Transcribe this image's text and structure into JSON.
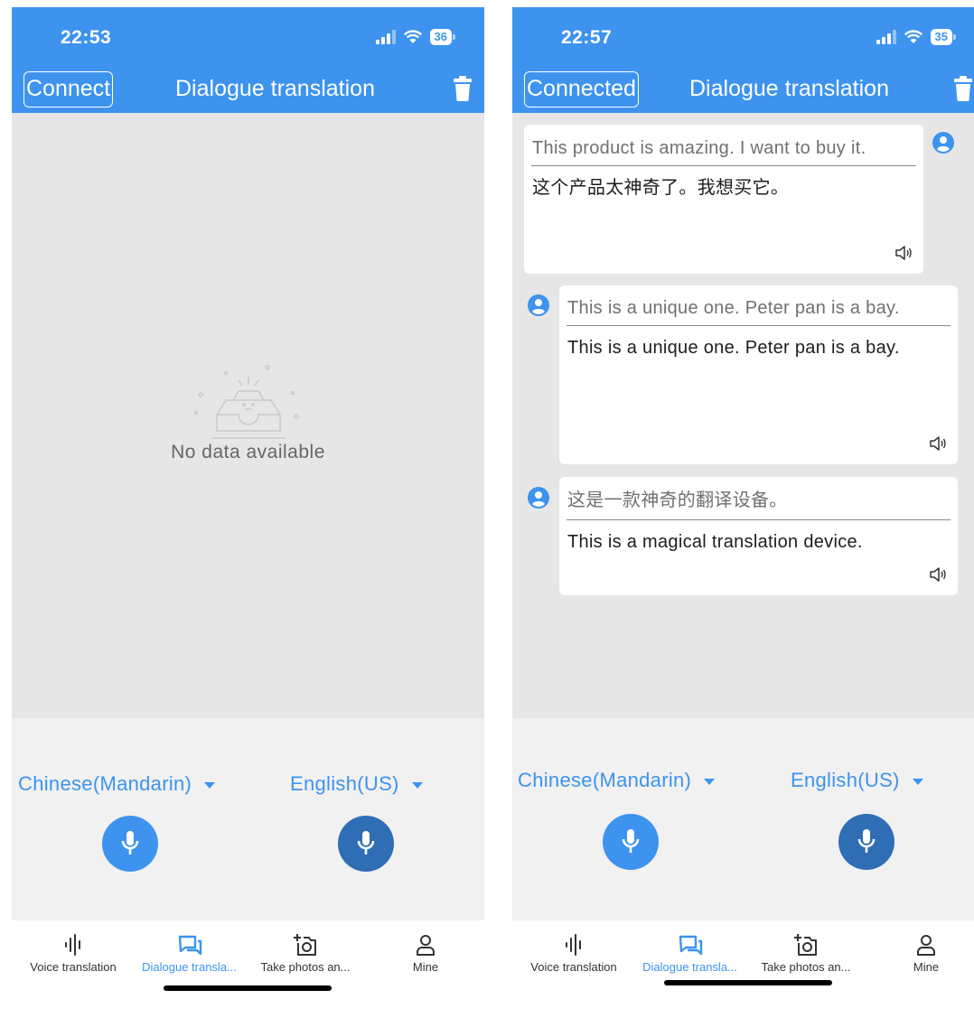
{
  "left": {
    "status": {
      "time": "22:53",
      "battery": "36"
    },
    "header": {
      "connect_label": "Connect",
      "title": "Dialogue translation"
    },
    "empty_text": "No data available",
    "languages": {
      "source": "Chinese(Mandarin)",
      "target": "English(US)"
    },
    "tabs": [
      {
        "label": "Voice translation",
        "icon": "waveform-icon"
      },
      {
        "label": "Dialogue transla...",
        "icon": "chat-icon"
      },
      {
        "label": "Take photos an...",
        "icon": "camera-icon"
      },
      {
        "label": "Mine",
        "icon": "person-icon"
      }
    ]
  },
  "right": {
    "status": {
      "time": "22:57",
      "battery": "35"
    },
    "header": {
      "connect_label": "Connected",
      "title": "Dialogue translation"
    },
    "messages": [
      {
        "speaker": "target",
        "source": "This product is amazing. I want to buy it.",
        "translation": "这个产品太神奇了。我想买它。"
      },
      {
        "speaker": "source",
        "source": "This is a unique one. Peter pan is a bay.",
        "translation": "This is a unique one. Peter pan is a bay."
      },
      {
        "speaker": "source",
        "source": "这是一款神奇的翻译设备。",
        "translation": "This is a magical translation device."
      }
    ],
    "languages": {
      "source": "Chinese(Mandarin)",
      "target": "English(US)"
    },
    "tabs": [
      {
        "label": "Voice translation",
        "icon": "waveform-icon"
      },
      {
        "label": "Dialogue transla...",
        "icon": "chat-icon"
      },
      {
        "label": "Take photos an...",
        "icon": "camera-icon"
      },
      {
        "label": "Mine",
        "icon": "person-icon"
      }
    ]
  },
  "colors": {
    "primary": "#3d93ee",
    "mic_dark": "#2f6db4",
    "content_bg": "#e6e6e6"
  }
}
